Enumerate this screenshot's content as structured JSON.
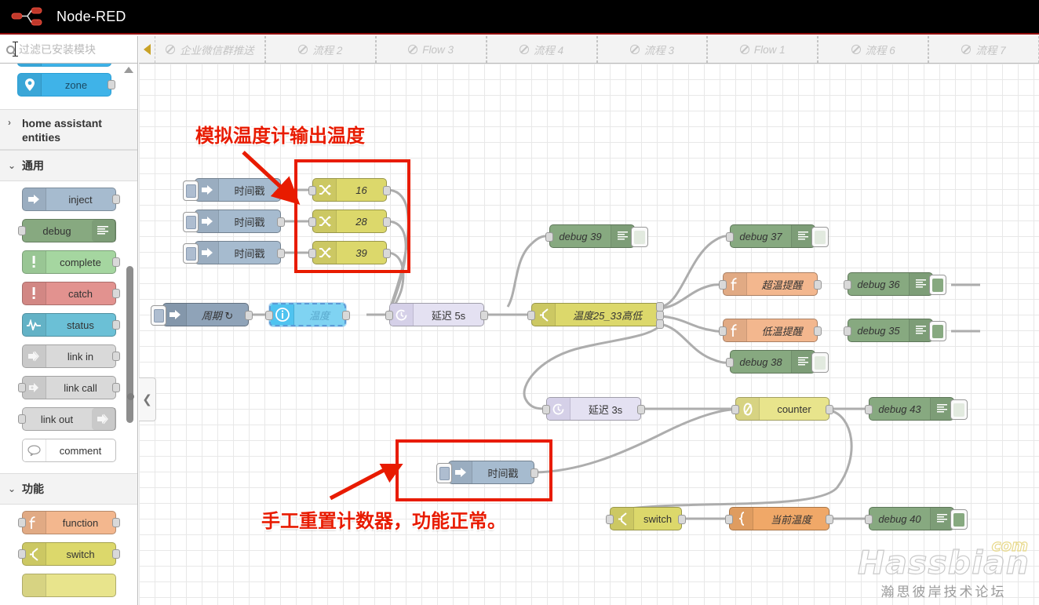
{
  "header": {
    "brand": "Node-RED",
    "logo_icon": "node-red-logo-icon"
  },
  "palette_search": {
    "placeholder": "过滤已安装模块",
    "value": "",
    "icon": "search-icon"
  },
  "sidebar": {
    "top_partial_node": {
      "label": "zone",
      "icon": "map-pin-icon",
      "color": "#3fb3e8"
    },
    "categories": [
      {
        "label": "home assistant entities",
        "expanded": false,
        "chevron": "chevron-right-icon",
        "nodes": []
      },
      {
        "label": "通用",
        "expanded": true,
        "chevron": "chevron-down-icon",
        "nodes": [
          {
            "label": "inject",
            "icon": "arrow-right-icon",
            "color": "#a6bbcf",
            "ports": "out"
          },
          {
            "label": "debug",
            "icon": "debug-lines-icon",
            "color": "#87a980",
            "ports": "in",
            "icon_side": "right"
          },
          {
            "label": "complete",
            "icon": "exclamation-icon",
            "color": "#a5d6a0",
            "ports": "out"
          },
          {
            "label": "catch",
            "icon": "exclamation-icon",
            "color": "#e2928f",
            "ports": "out"
          },
          {
            "label": "status",
            "icon": "pulse-icon",
            "color": "#6bc0d6",
            "ports": "out"
          },
          {
            "label": "link in",
            "icon": "link-icon",
            "color": "#d9d9d9",
            "ports": "out"
          },
          {
            "label": "link call",
            "icon": "link-call-icon",
            "color": "#d9d9d9",
            "ports": "both"
          },
          {
            "label": "link out",
            "icon": "link-icon",
            "color": "#d9d9d9",
            "ports": "in",
            "icon_side": "right"
          },
          {
            "label": "comment",
            "icon": "speech-bubble-icon",
            "color": "#ffffff",
            "ports": "none"
          }
        ]
      },
      {
        "label": "功能",
        "expanded": true,
        "chevron": "chevron-down-icon",
        "nodes": [
          {
            "label": "function",
            "icon": "function-f-icon",
            "color": "#f3b78e",
            "ports": "both"
          },
          {
            "label": "switch",
            "icon": "switch-fork-icon",
            "color": "#e2d96e",
            "ports": "both"
          }
        ]
      }
    ]
  },
  "tabs": {
    "collapse_icon": "triangle-left-icon",
    "items": [
      {
        "label": "企业微信群推送",
        "icon": "disabled-circle-icon",
        "disabled": true
      },
      {
        "label": "流程 2",
        "icon": "disabled-circle-icon",
        "disabled": true
      },
      {
        "label": "Flow 3",
        "icon": "disabled-circle-icon",
        "disabled": true
      },
      {
        "label": "流程 4",
        "icon": "disabled-circle-icon",
        "disabled": true
      },
      {
        "label": "流程 3",
        "icon": "disabled-circle-icon",
        "disabled": true
      },
      {
        "label": "Flow 1",
        "icon": "disabled-circle-icon",
        "disabled": true
      },
      {
        "label": "流程 6",
        "icon": "disabled-circle-icon",
        "disabled": true
      },
      {
        "label": "流程 7",
        "icon": "disabled-circle-icon",
        "disabled": true
      }
    ]
  },
  "canvas": {
    "collapse_icon": "chevron-left-icon",
    "nodes": [
      {
        "id": "inject1",
        "label": "时间戳",
        "type": "inject",
        "icon": "arrow-right-icon",
        "color": "#a6bbcf"
      },
      {
        "id": "inject2",
        "label": "时间戳",
        "type": "inject",
        "icon": "arrow-right-icon",
        "color": "#a6bbcf"
      },
      {
        "id": "inject3",
        "label": "时间戳",
        "type": "inject",
        "icon": "arrow-right-icon",
        "color": "#a6bbcf"
      },
      {
        "id": "rnd1",
        "label": "16",
        "type": "random",
        "icon": "shuffle-icon",
        "color": "#dcd86b"
      },
      {
        "id": "rnd2",
        "label": "28",
        "type": "random",
        "icon": "shuffle-icon",
        "color": "#dcd86b"
      },
      {
        "id": "rnd3",
        "label": "39",
        "type": "random",
        "icon": "shuffle-icon",
        "color": "#dcd86b"
      },
      {
        "id": "injcycle",
        "label": "周期 ↻",
        "type": "inject",
        "icon": "arrow-right-icon",
        "color": "#8fa3b8"
      },
      {
        "id": "temp",
        "label": "温度",
        "type": "status",
        "icon": "info-circle-icon",
        "color": "#4fc3f0",
        "selected": true
      },
      {
        "id": "delay5",
        "label": "延迟 5s",
        "type": "delay",
        "icon": "clock-icon",
        "color": "#e0ddf0"
      },
      {
        "id": "dbg39",
        "label": "debug 39",
        "type": "debug",
        "icon": "debug-lines-icon",
        "color": "#87a980",
        "active": false
      },
      {
        "id": "sw1",
        "label": "温度25_33高低",
        "type": "switch",
        "icon": "switch-fork-icon",
        "color": "#dcd86b"
      },
      {
        "id": "dbg37",
        "label": "debug 37",
        "type": "debug",
        "icon": "debug-lines-icon",
        "color": "#87a980",
        "active": false
      },
      {
        "id": "fn1",
        "label": "超温提醒",
        "type": "function",
        "icon": "function-f-icon",
        "color": "#f3b78e"
      },
      {
        "id": "dbg36",
        "label": "debug 36",
        "type": "debug",
        "icon": "debug-lines-icon",
        "color": "#87a980",
        "active": true
      },
      {
        "id": "fn2",
        "label": "低温提醒",
        "type": "function",
        "icon": "function-f-icon",
        "color": "#f3b78e"
      },
      {
        "id": "dbg35",
        "label": "debug 35",
        "type": "debug",
        "icon": "debug-lines-icon",
        "color": "#87a980",
        "active": true
      },
      {
        "id": "dbg38",
        "label": "debug 38",
        "type": "debug",
        "icon": "debug-lines-icon",
        "color": "#87a980",
        "active": false
      },
      {
        "id": "delay3",
        "label": "延迟 3s",
        "type": "delay",
        "icon": "clock-icon",
        "color": "#e0ddf0"
      },
      {
        "id": "counter",
        "label": "counter",
        "type": "counter",
        "icon": "zero-slash-icon",
        "color": "#e8e48c"
      },
      {
        "id": "dbg43",
        "label": "debug 43",
        "type": "debug",
        "icon": "debug-lines-icon",
        "color": "#87a980",
        "active": false
      },
      {
        "id": "injreset",
        "label": "时间戳",
        "type": "inject",
        "icon": "arrow-right-icon",
        "color": "#a6bbcf"
      },
      {
        "id": "sw2",
        "label": "switch",
        "type": "switch",
        "icon": "switch-fork-icon",
        "color": "#dcd86b"
      },
      {
        "id": "tmpl",
        "label": "当前温度",
        "type": "template",
        "icon": "brace-icon",
        "color": "#f0a868"
      },
      {
        "id": "dbg40",
        "label": "debug 40",
        "type": "debug",
        "icon": "debug-lines-icon",
        "color": "#87a980",
        "active": true
      }
    ],
    "annotations": [
      {
        "id": "anno1",
        "text": "模拟温度计输出温度",
        "color": "#e81b00"
      },
      {
        "id": "anno2",
        "text": "手工重置计数器，功能正常。",
        "color": "#e81b00"
      }
    ],
    "highlight_boxes": [
      {
        "id": "box1",
        "color": "#e81b00"
      },
      {
        "id": "box2",
        "color": "#e81b00"
      }
    ]
  },
  "watermark": {
    "main": "Hassbian",
    "tld": "com",
    "sub": "瀚思彼岸技术论坛"
  }
}
